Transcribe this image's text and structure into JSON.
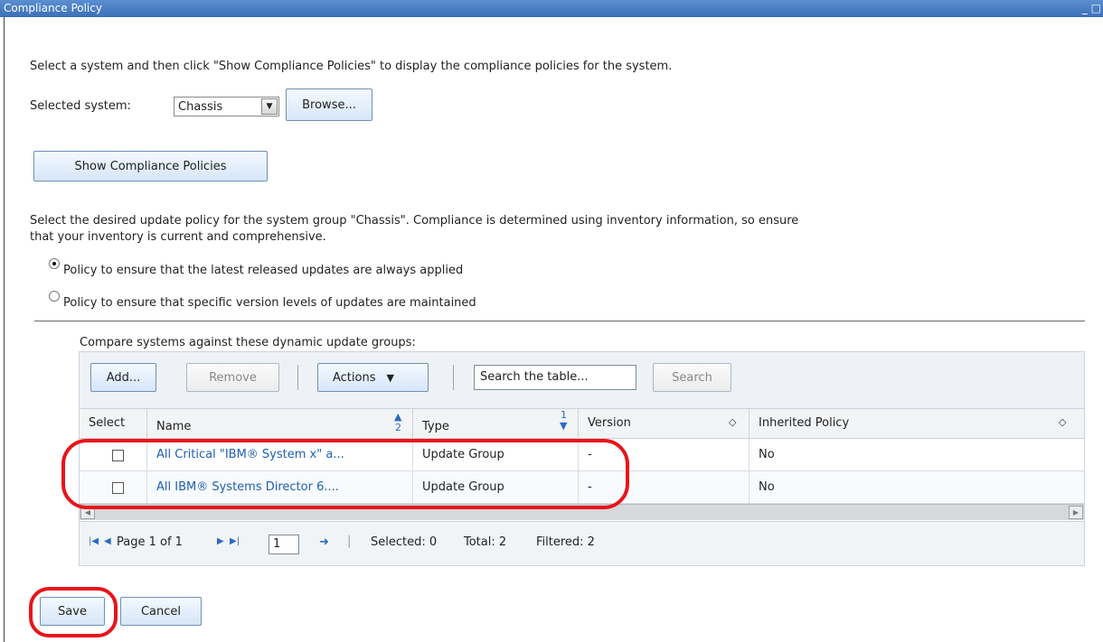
{
  "window": {
    "title": "Compliance Policy",
    "controls": "_ □"
  },
  "intro": {
    "text": "Select a system and then click \"Show Compliance Policies\" to display the compliance policies for the system."
  },
  "system": {
    "label": "Selected system:",
    "value": "Chassis",
    "browse_label": "Browse..."
  },
  "show_button": {
    "label": "Show Compliance Policies"
  },
  "policy_select": {
    "text_line1": "Select the desired update policy for the system group \"Chassis\". Compliance is determined using inventory information, so ensure",
    "text_line2": "that your inventory is current and comprehensive.",
    "options": [
      {
        "label": "Policy to ensure that the latest released updates are always applied",
        "checked": true
      },
      {
        "label": "Policy to ensure that specific version levels of updates are maintained",
        "checked": false
      }
    ]
  },
  "compare": {
    "label": "Compare systems against these dynamic update groups:"
  },
  "toolbar": {
    "add_label": "Add...",
    "remove_label": "Remove",
    "actions_label": "Actions",
    "search_value": "Search the table...",
    "search_label": "Search"
  },
  "table": {
    "headers": {
      "select": "Select",
      "name": "Name",
      "name_sort": "2",
      "type": "Type",
      "type_sort": "1",
      "version": "Version",
      "inherited": "Inherited Policy"
    },
    "rows": [
      {
        "name": "All Critical \"IBM® System x\" a...",
        "type": "Update Group",
        "version": "-",
        "inherited": "No"
      },
      {
        "name": "All IBM® Systems Director 6....",
        "type": "Update Group",
        "version": "-",
        "inherited": "No"
      }
    ]
  },
  "pager": {
    "page_text": "Page 1 of 1",
    "page_input": "1",
    "selected": "Selected: 0",
    "total": "Total: 2",
    "filtered": "Filtered: 2"
  },
  "footer": {
    "save_label": "Save",
    "cancel_label": "Cancel"
  },
  "colors": {
    "title_bar": "#3b6fb6",
    "link": "#1e5fb3",
    "annotation": "#e8141b"
  }
}
